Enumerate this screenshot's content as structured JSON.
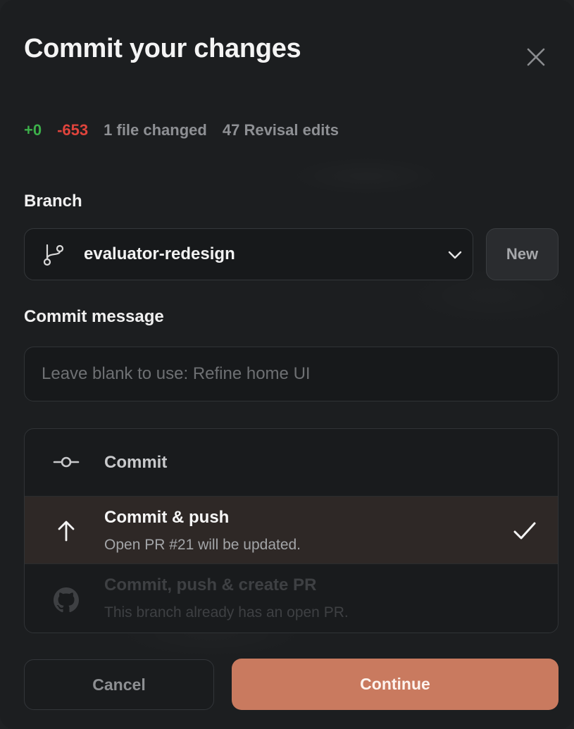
{
  "dialog": {
    "title": "Commit your changes"
  },
  "stats": {
    "additions": "+0",
    "deletions": "-653",
    "files_changed": "1 file changed",
    "revisal_edits": "47 Revisal edits"
  },
  "branch": {
    "label": "Branch",
    "selected": "evaluator-redesign",
    "new_button": "New"
  },
  "commit_message": {
    "label": "Commit message",
    "placeholder": "Leave blank to use: Refine home UI",
    "value": ""
  },
  "options": [
    {
      "title": "Commit",
      "subtitle": "",
      "icon": "commit-icon",
      "selected": false,
      "disabled": false
    },
    {
      "title": "Commit & push",
      "subtitle": "Open PR #21 will be updated.",
      "icon": "arrow-up-icon",
      "selected": true,
      "disabled": false
    },
    {
      "title": "Commit, push & create PR",
      "subtitle": "This branch already has an open PR.",
      "icon": "github-icon",
      "selected": false,
      "disabled": true
    }
  ],
  "actions": {
    "cancel": "Cancel",
    "continue": "Continue"
  },
  "colors": {
    "additions": "#3cb04a",
    "deletions": "#e0443c",
    "accent": "#c97a5f",
    "selected_row": "#2e2826"
  }
}
